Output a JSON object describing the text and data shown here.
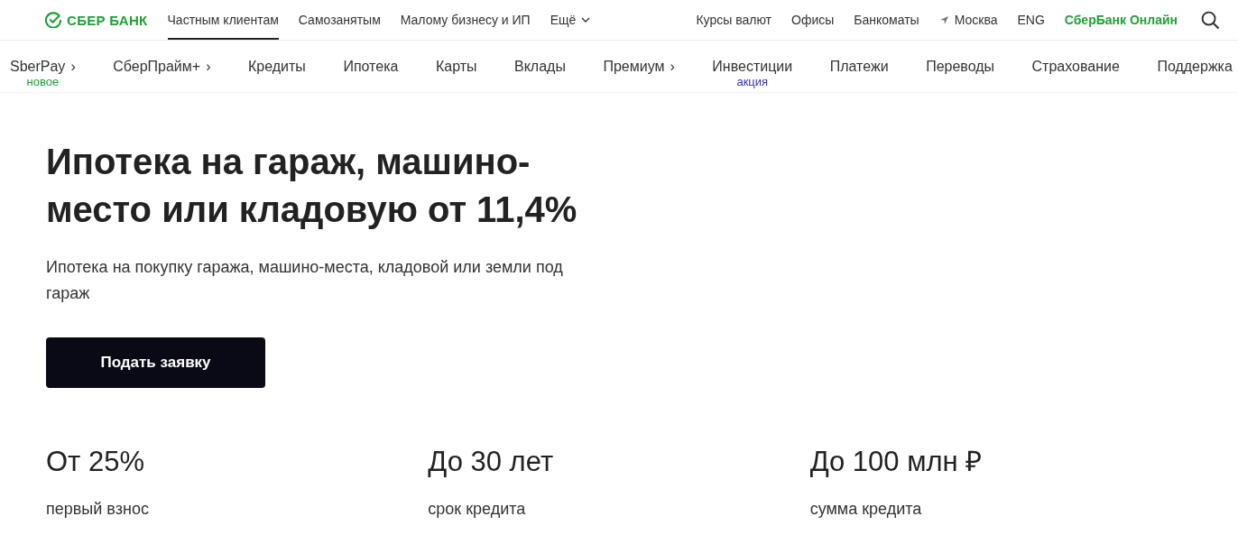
{
  "header": {
    "logo": "СБЕР БАНК",
    "nav": [
      {
        "label": "Частным клиентам",
        "selected": true
      },
      {
        "label": "Самозанятым",
        "selected": false
      },
      {
        "label": "Малому бизнесу и ИП",
        "selected": false
      },
      {
        "label": "Ещё",
        "selected": false,
        "dropdown": true
      }
    ],
    "links": [
      {
        "label": "Курсы валют",
        "kind": "plain"
      },
      {
        "label": "Офисы",
        "kind": "plain"
      },
      {
        "label": "Банкоматы",
        "kind": "plain"
      },
      {
        "label": "Москва",
        "kind": "location"
      },
      {
        "label": "ENG",
        "kind": "plain"
      },
      {
        "label": "СберБанк Онлайн",
        "kind": "accent"
      }
    ]
  },
  "menu": [
    {
      "label": "SberPay",
      "chevron": "›",
      "badge": "новое",
      "color": "#21a038"
    },
    {
      "label": "СберПрайм+",
      "chevron": "›"
    },
    {
      "label": "Кредиты"
    },
    {
      "label": "Ипотека"
    },
    {
      "label": "Карты"
    },
    {
      "label": "Вклады"
    },
    {
      "label": "Премиум",
      "chevron": "›"
    },
    {
      "label": "Инвестиции",
      "badge": "акция",
      "color": "#3333aa"
    },
    {
      "label": "Платежи"
    },
    {
      "label": "Переводы"
    },
    {
      "label": "Страхование"
    },
    {
      "label": "Поддержка"
    }
  ],
  "hero": {
    "title": "Ипотека на гараж, машино-место или кладовую от 11,4%",
    "subtitle": "Ипотека на покупку гаража, машино-места, кладовой или земли под гараж",
    "button": "Подать заявку"
  },
  "stats": [
    {
      "value": "От 25%",
      "label": "первый взнос"
    },
    {
      "value": "До 30 лет",
      "label": "срок кредита"
    },
    {
      "value": "До 100 млн ₽",
      "label": "сумма кредита"
    }
  ]
}
